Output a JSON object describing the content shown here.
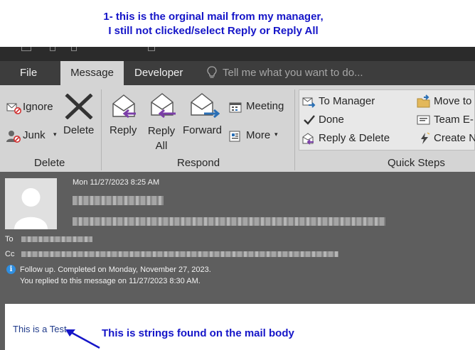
{
  "annotations": {
    "top_line1": "1- this is the orginal mail from my manager,",
    "top_line2": "I still not clicked/select Reply or Reply All",
    "body_note": "This is strings found on the mail body"
  },
  "tabs": {
    "file": "File",
    "message": "Message",
    "developer": "Developer",
    "tell_me": "Tell me what you want to do..."
  },
  "ribbon": {
    "delete_group": {
      "ignore": "Ignore",
      "junk": "Junk",
      "delete": "Delete",
      "label": "Delete"
    },
    "respond_group": {
      "reply": "Reply",
      "reply_all_line1": "Reply",
      "reply_all_line2": "All",
      "forward": "Forward",
      "meeting": "Meeting",
      "more": "More",
      "label": "Respond"
    },
    "quick_steps": {
      "to_manager": "To Manager",
      "done": "Done",
      "reply_delete": "Reply & Delete",
      "move_to": "Move to",
      "team_email": "Team E-",
      "create_new": "Create N",
      "label": "Quick Steps"
    }
  },
  "message": {
    "date": "Mon 11/27/2023 8:25 AM",
    "to_label": "To",
    "cc_label": "Cc",
    "followup_line1": "Follow up.  Completed on Monday, November 27, 2023.",
    "followup_line2": "You replied to this message on 11/27/2023 8:30 AM.",
    "body_text": "This is a Test"
  },
  "colors": {
    "annotation": "#1515c8",
    "ribbon_bg": "#d4d4d4",
    "header_bg": "#5e5e5e",
    "reply_arrow": "#7b3ea8",
    "forward_arrow": "#2a6fb5"
  }
}
